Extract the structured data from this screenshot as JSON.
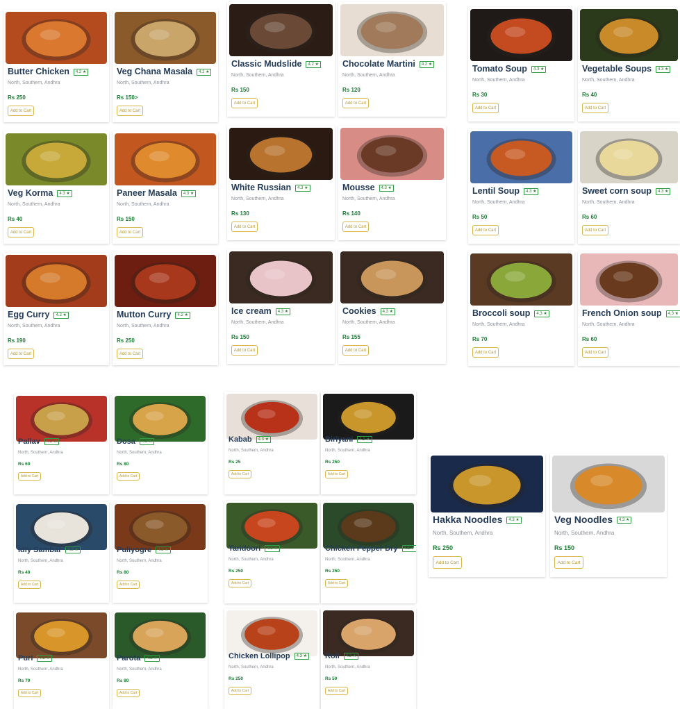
{
  "common": {
    "subtitle": "North, Southern, Andhra",
    "add_to_cart": "Add to Cart"
  },
  "groups": [
    {
      "name": "main-course",
      "items": [
        {
          "name": "Butter Chicken",
          "rating": "4.2",
          "price": "Rs 250",
          "image": "butter-chicken",
          "colors": [
            "#b44b1f",
            "#d9782e"
          ]
        },
        {
          "name": "Veg Chana Masala",
          "rating": "4.2",
          "price": "Rs 150>",
          "image": "chana-masala",
          "colors": [
            "#8a5a2b",
            "#c9a56a"
          ]
        },
        {
          "name": "Veg Korma",
          "rating": "4.3",
          "price": "Rs 40",
          "image": "veg-korma",
          "colors": [
            "#7a8a2a",
            "#c7a93a"
          ]
        },
        {
          "name": "Paneer Masala",
          "rating": "4.3",
          "price": "Rs 150",
          "image": "paneer-masala",
          "colors": [
            "#c2581f",
            "#e08a2e"
          ]
        },
        {
          "name": "Egg Curry",
          "rating": "4.2",
          "price": "Rs 190",
          "image": "egg-curry",
          "colors": [
            "#a23c1a",
            "#d47a2a"
          ]
        },
        {
          "name": "Mutton Curry",
          "rating": "4.2",
          "price": "Rs 250",
          "image": "mutton-curry",
          "colors": [
            "#6e1e10",
            "#a8381c"
          ]
        }
      ]
    },
    {
      "name": "desserts-drinks",
      "items": [
        {
          "name": "Classic Mudslide",
          "rating": "4.2",
          "price": "Rs 150",
          "image": "mudslide",
          "colors": [
            "#2b1d16",
            "#6a4a36"
          ]
        },
        {
          "name": "Chocolate Martini",
          "rating": "4.2",
          "price": "Rs 120",
          "image": "chocolate-martini",
          "colors": [
            "#e8ddd2",
            "#a07a5a"
          ]
        },
        {
          "name": "White Russian",
          "rating": "4.3",
          "price": "Rs 130",
          "image": "white-russian",
          "colors": [
            "#2a1a12",
            "#b8732e"
          ]
        },
        {
          "name": "Mousse",
          "rating": "4.3",
          "price": "Rs 140",
          "image": "mousse",
          "colors": [
            "#d88c86",
            "#6b3a26"
          ]
        },
        {
          "name": "Ice cream",
          "rating": "4.3",
          "price": "Rs 150",
          "image": "ice-cream",
          "colors": [
            "#3b2a22",
            "#e8c4c8"
          ]
        },
        {
          "name": "Cookies",
          "rating": "4.3",
          "price": "Rs 155",
          "image": "cookies",
          "colors": [
            "#3a2a22",
            "#c8955a"
          ]
        }
      ]
    },
    {
      "name": "soups",
      "items": [
        {
          "name": "Tomato Soup",
          "rating": "4.3",
          "price": "Rs 30",
          "image": "tomato-soup",
          "colors": [
            "#1f1a18",
            "#c44a20"
          ]
        },
        {
          "name": "Vegetable Soups",
          "rating": "4.3",
          "price": "Rs 40",
          "image": "vegetable-soup",
          "colors": [
            "#2a3a1a",
            "#c98a2a"
          ]
        },
        {
          "name": "Lentil Soup",
          "rating": "4.3",
          "price": "Rs 50",
          "image": "lentil-soup",
          "colors": [
            "#4a6ea8",
            "#c75a22"
          ]
        },
        {
          "name": "Sweet corn soup",
          "rating": "4.3",
          "price": "Rs 60",
          "image": "sweet-corn-soup",
          "colors": [
            "#d8d4c8",
            "#e8d89a"
          ]
        },
        {
          "name": "Broccoli soup",
          "rating": "4.3",
          "price": "Rs 70",
          "image": "broccoli-soup",
          "colors": [
            "#5a3a22",
            "#8aa83a"
          ]
        },
        {
          "name": "French Onion soup",
          "rating": "4.3",
          "price": "Rs 60",
          "image": "french-onion-soup",
          "colors": [
            "#e8b8b8",
            "#6a3a1e"
          ]
        }
      ]
    },
    {
      "name": "south-indian",
      "items": [
        {
          "name": "Pallav",
          "rating": "4.2",
          "price": "Rs 60",
          "image": "pallav",
          "colors": [
            "#b8322a",
            "#c9a04a"
          ]
        },
        {
          "name": "Dosa",
          "rating": "4.3",
          "price": "Rs 80",
          "image": "dosa",
          "colors": [
            "#2e6a2a",
            "#d8a44a"
          ]
        },
        {
          "name": "Idly Sambar",
          "rating": "4.3",
          "price": "Rs 40",
          "image": "idly-sambar",
          "colors": [
            "#2a4a6a",
            "#e8e4dc"
          ]
        },
        {
          "name": "Puliyogre",
          "rating": "4.3",
          "price": "Rs 80",
          "image": "puliyogre",
          "colors": [
            "#7a3a1a",
            "#8a5a2a"
          ]
        },
        {
          "name": "Puri",
          "rating": "4.3",
          "price": "Rs 70",
          "image": "puri",
          "colors": [
            "#7a4a2a",
            "#d8962a"
          ]
        },
        {
          "name": "Parota",
          "rating": "4.3",
          "price": "Rs 80",
          "image": "parota",
          "colors": [
            "#2a5a2a",
            "#d8a45a"
          ]
        }
      ]
    },
    {
      "name": "non-veg-starters",
      "items": [
        {
          "name": "Kabab",
          "rating": "4.3",
          "price": "Rs 25",
          "image": "kabab",
          "colors": [
            "#e8e0d8",
            "#b8321a"
          ]
        },
        {
          "name": "Biriyani",
          "rating": "4.3",
          "price": "Rs 250",
          "image": "biriyani",
          "colors": [
            "#1a1a1a",
            "#c8962a"
          ]
        },
        {
          "name": "Tandoori",
          "rating": "4.3",
          "price": "Rs 250",
          "image": "tandoori",
          "colors": [
            "#3a5a2a",
            "#c8461e"
          ]
        },
        {
          "name": "Chicken Pepper Dry",
          "rating": "4.3",
          "price": "Rs 250",
          "image": "chicken-pepper-dry",
          "colors": [
            "#2a4a2a",
            "#5a3a1a"
          ]
        },
        {
          "name": "Chicken Lollipop",
          "rating": "4.3",
          "price": "Rs 250",
          "image": "chicken-lollipop",
          "colors": [
            "#f4f0ec",
            "#b8421a"
          ]
        },
        {
          "name": "Roll",
          "rating": "4.3",
          "price": "Rs 50",
          "image": "roll",
          "colors": [
            "#3a2a22",
            "#d8a46a"
          ]
        }
      ]
    },
    {
      "name": "noodles",
      "items": [
        {
          "name": "Hakka Noodles",
          "rating": "4.3",
          "price": "Rs 250",
          "image": "hakka-noodles",
          "colors": [
            "#1a2a4a",
            "#c8962a"
          ]
        },
        {
          "name": "Veg Noodles",
          "rating": "4.3",
          "price": "Rs 150",
          "image": "veg-noodles",
          "colors": [
            "#d8d8d8",
            "#d88a2a"
          ]
        }
      ]
    }
  ]
}
